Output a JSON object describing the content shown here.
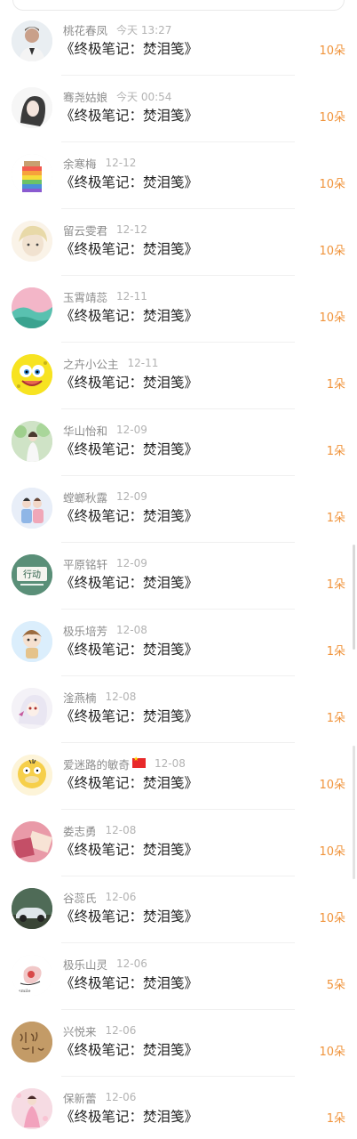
{
  "rows": [
    {
      "name": "桃花春凤",
      "time": "今天 13:27",
      "title": "《终极笔记：焚泪笺》",
      "amount": "10朵",
      "avatar": "avatar-man-photo"
    },
    {
      "name": "骞尧姑娘",
      "time": "今天 00:54",
      "title": "《终极笔记：焚泪笺》",
      "amount": "10朵",
      "avatar": "avatar-girl-sketch"
    },
    {
      "name": "余寒梅",
      "time": "12-12",
      "title": "《终极笔记：焚泪笺》",
      "amount": "10朵",
      "avatar": "avatar-rainbow-jar"
    },
    {
      "name": "留云雯君",
      "time": "12-12",
      "title": "《终极笔记：焚泪笺》",
      "amount": "10朵",
      "avatar": "avatar-anime-boy"
    },
    {
      "name": "玉霄靖蕊",
      "time": "12-11",
      "title": "《终极笔记：焚泪笺》",
      "amount": "10朵",
      "avatar": "avatar-landscape"
    },
    {
      "name": "之卉小公主",
      "time": "12-11",
      "title": "《终极笔记：焚泪笺》",
      "amount": "1朵",
      "avatar": "avatar-spongebob"
    },
    {
      "name": "华山怡和",
      "time": "12-09",
      "title": "《终极笔记：焚泪笺》",
      "amount": "1朵",
      "avatar": "avatar-girl-garden"
    },
    {
      "name": "螳螂秋露",
      "time": "12-09",
      "title": "《终极笔记：焚泪笺》",
      "amount": "1朵",
      "avatar": "avatar-couple"
    },
    {
      "name": "平原铭轩",
      "time": "12-09",
      "title": "《终极笔记：焚泪笺》",
      "amount": "1朵",
      "avatar": "avatar-action-text",
      "avatar_text": "行动"
    },
    {
      "name": "极乐培芳",
      "time": "12-08",
      "title": "《终极笔记：焚泪笺》",
      "amount": "1朵",
      "avatar": "avatar-chibi"
    },
    {
      "name": "淦燕楠",
      "time": "12-08",
      "title": "《终极笔记：焚泪笺》",
      "amount": "1朵",
      "avatar": "avatar-anime-white-hair"
    },
    {
      "name": "爱迷路的敏奇",
      "time": "12-08",
      "title": "《终极笔记：焚泪笺》",
      "amount": "10朵",
      "avatar": "avatar-psyduck",
      "flag": true
    },
    {
      "name": "娄志勇",
      "time": "12-08",
      "title": "《终极笔记：焚泪笺》",
      "amount": "10朵",
      "avatar": "avatar-pink-envelope"
    },
    {
      "name": "谷蕊氏",
      "time": "12-06",
      "title": "《终极笔记：焚泪笺》",
      "amount": "10朵",
      "avatar": "avatar-vintage-car"
    },
    {
      "name": "极乐山灵",
      "time": "12-06",
      "title": "《终极笔记：焚泪笺》",
      "amount": "5朵",
      "avatar": "avatar-hand-sketch"
    },
    {
      "name": "兴悦来",
      "time": "12-06",
      "title": "《终极笔记：焚泪笺》",
      "amount": "10朵",
      "avatar": "avatar-calligraphy"
    },
    {
      "name": "保新蕾",
      "time": "12-06",
      "title": "《终极笔记：焚泪笺》",
      "amount": "1朵",
      "avatar": "avatar-pink-dress"
    }
  ],
  "colors": {
    "name": "#8c8c8c",
    "time": "#b3b3b3",
    "title": "#222222",
    "amount": "#f0933a",
    "divider": "#f0f0f0"
  }
}
